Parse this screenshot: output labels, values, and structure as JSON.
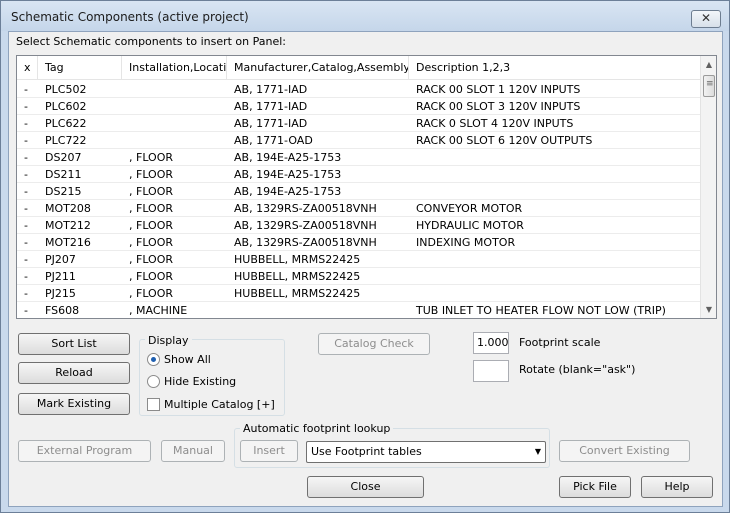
{
  "window": {
    "title": "Schematic Components (active project)",
    "close_glyph": "✕"
  },
  "instructions": "Select Schematic components to insert on Panel:",
  "table": {
    "headers": [
      "x",
      "Tag",
      "Installation,Location",
      "Manufacturer,Catalog,Assembly",
      "Description 1,2,3"
    ],
    "rows": [
      [
        "-",
        "PLC502",
        "",
        "AB, 1771-IAD",
        "RACK 00 SLOT 1 120V INPUTS"
      ],
      [
        "-",
        "PLC602",
        "",
        "AB, 1771-IAD",
        "RACK 00 SLOT 3 120V INPUTS"
      ],
      [
        "-",
        "PLC622",
        "",
        "AB, 1771-IAD",
        "RACK 0 SLOT 4 120V INPUTS"
      ],
      [
        "-",
        "PLC722",
        "",
        "AB, 1771-OAD",
        "RACK 00 SLOT 6 120V OUTPUTS"
      ],
      [
        "-",
        "DS207",
        ", FLOOR",
        "AB, 194E-A25-1753",
        ""
      ],
      [
        "-",
        "DS211",
        ", FLOOR",
        "AB, 194E-A25-1753",
        ""
      ],
      [
        "-",
        "DS215",
        ", FLOOR",
        "AB, 194E-A25-1753",
        ""
      ],
      [
        "-",
        "MOT208",
        ", FLOOR",
        "AB, 1329RS-ZA00518VNH",
        "CONVEYOR MOTOR"
      ],
      [
        "-",
        "MOT212",
        ", FLOOR",
        "AB, 1329RS-ZA00518VNH",
        "HYDRAULIC MOTOR"
      ],
      [
        "-",
        "MOT216",
        ", FLOOR",
        "AB, 1329RS-ZA00518VNH",
        "INDEXING MOTOR"
      ],
      [
        "-",
        "PJ207",
        ", FLOOR",
        "HUBBELL, MRMS22425",
        ""
      ],
      [
        "-",
        "PJ211",
        ", FLOOR",
        "HUBBELL, MRMS22425",
        ""
      ],
      [
        "-",
        "PJ215",
        ", FLOOR",
        "HUBBELL, MRMS22425",
        ""
      ],
      [
        "-",
        "FS608",
        ", MACHINE",
        "",
        "TUB INLET TO HEATER FLOW NOT LOW (TRIP)"
      ]
    ],
    "scroll_up_glyph": "▲",
    "scroll_down_glyph": "▼"
  },
  "buttons": {
    "sort_list": "Sort List",
    "reload": "Reload",
    "mark_existing": "Mark Existing",
    "catalog_check": "Catalog Check",
    "external_program": "External Program",
    "manual": "Manual",
    "insert": "Insert",
    "convert_existing": "Convert Existing",
    "close": "Close",
    "pick_file": "Pick File",
    "help": "Help"
  },
  "display": {
    "group_label": "Display",
    "show_all": "Show All",
    "hide_existing": "Hide Existing",
    "multiple_catalog": "Multiple Catalog [+]",
    "selected": "show_all",
    "multiple_catalog_checked": false
  },
  "footprint": {
    "scale_value": "1.000",
    "scale_label": "Footprint scale",
    "rotate_value": "",
    "rotate_label": "Rotate (blank=\"ask\")"
  },
  "lookup": {
    "group_label": "Automatic footprint lookup",
    "select_value": "Use Footprint tables",
    "dropdown_glyph": "▼"
  }
}
